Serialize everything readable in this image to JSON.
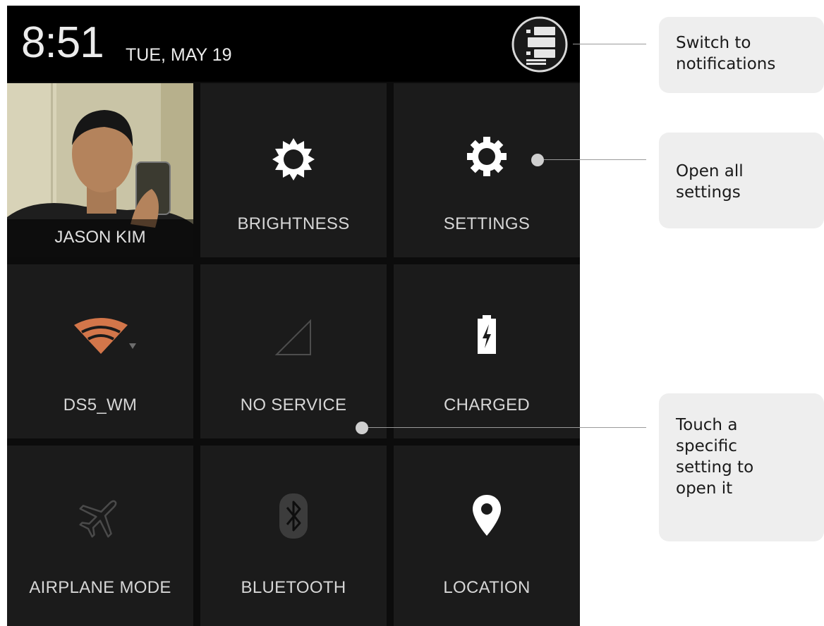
{
  "status": {
    "time": "8:51",
    "date": "TUE, MAY 19"
  },
  "user": {
    "name": "JASON KIM"
  },
  "tiles": [
    {
      "label": "BRIGHTNESS",
      "icon": "brightness-icon"
    },
    {
      "label": "SETTINGS",
      "icon": "gear-icon"
    },
    {
      "label": "DS5_WM",
      "icon": "wifi-icon"
    },
    {
      "label": "NO SERVICE",
      "icon": "signal-icon"
    },
    {
      "label": "CHARGED",
      "icon": "battery-charged-icon"
    },
    {
      "label": "AIRPLANE MODE",
      "icon": "airplane-icon"
    },
    {
      "label": "BLUETOOTH",
      "icon": "bluetooth-icon"
    },
    {
      "label": "LOCATION",
      "icon": "location-pin-icon"
    }
  ],
  "callouts": [
    {
      "text": "Switch to\nnotifications"
    },
    {
      "text": "Open all\nsettings"
    },
    {
      "text": "Touch a\nspecific\nsetting to\nopen it"
    }
  ],
  "colors": {
    "wifi_accent": "#d3764a",
    "tile_bg": "#1b1b1b",
    "callout_bg": "#eeeeee"
  }
}
